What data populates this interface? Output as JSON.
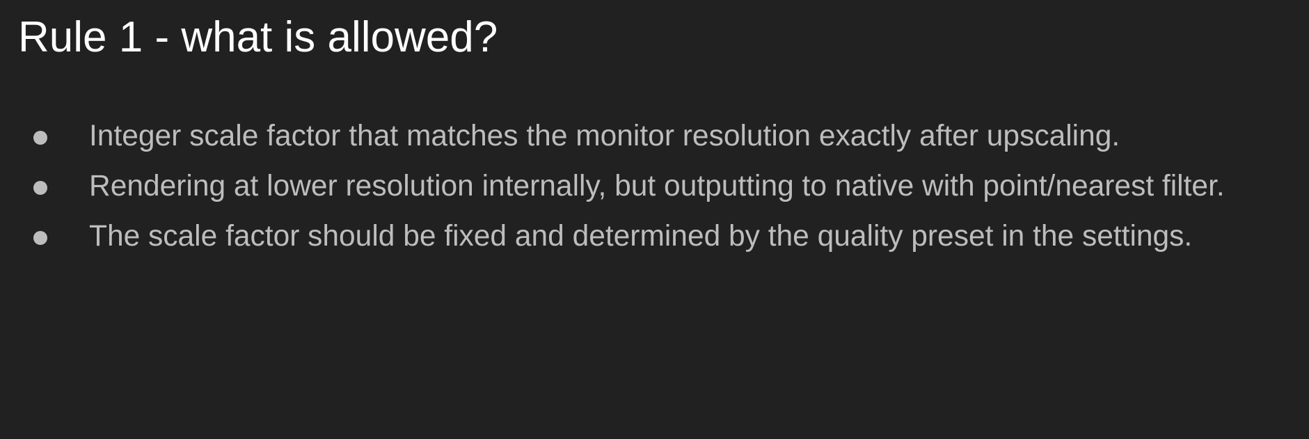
{
  "slide": {
    "title": "Rule 1 - what is allowed?",
    "bullets": [
      "Integer scale factor that matches the monitor resolution exactly after upscaling.",
      "Rendering at lower resolution internally, but outputting to native with point/nearest filter.",
      "The scale factor should be fixed and determined by the quality preset in the settings."
    ]
  },
  "colors": {
    "background": "#212121",
    "title": "#ffffff",
    "bullet_text": "#bdbdbd"
  }
}
